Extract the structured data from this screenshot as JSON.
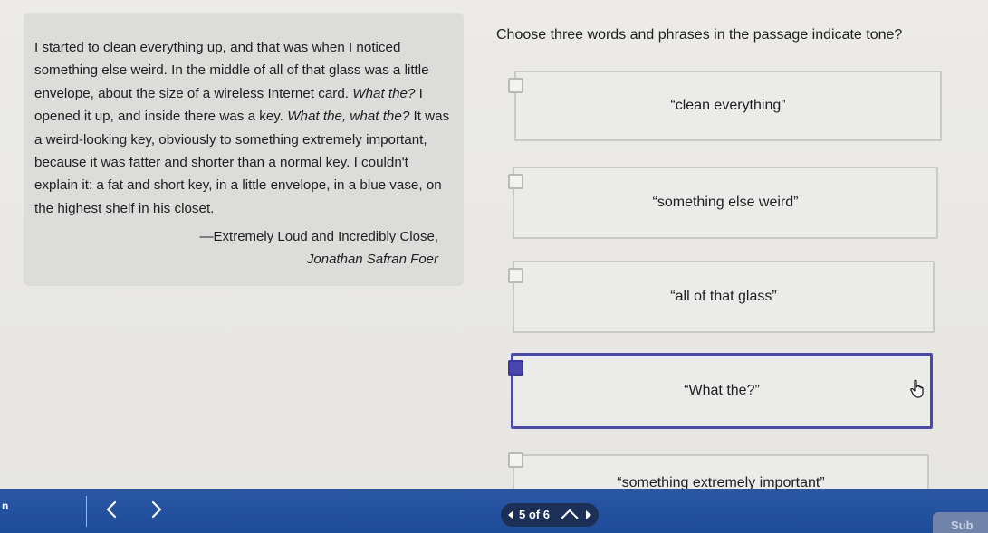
{
  "passage": {
    "segments": [
      {
        "text": "I started to clean everything up, and that was when I noticed something else weird. In the middle of all of that glass was a little envelope, about the size of a wireless Internet card. ",
        "italic": false
      },
      {
        "text": "What the?",
        "italic": true
      },
      {
        "text": " I opened it up, and inside there was a key. ",
        "italic": false
      },
      {
        "text": "What the, what the?",
        "italic": true
      },
      {
        "text": " It was a weird-looking key, obviously to something extremely important, because it was fatter and shorter than a normal key. I couldn't explain it: a fat and short key, in a little envelope, in a blue vase, on the highest shelf in his closet.",
        "italic": false
      }
    ],
    "source_title": "—Extremely Loud and Incredibly Close,",
    "author": "Jonathan Safran Foer"
  },
  "question": "Choose three words and phrases in the passage indicate tone?",
  "options": [
    {
      "label": "“clean everything”",
      "checked": false
    },
    {
      "label": "“something else weird”",
      "checked": false
    },
    {
      "label": "“all of that glass”",
      "checked": false
    },
    {
      "label": "“What the?”",
      "checked": true
    },
    {
      "label": "“something extremely important”",
      "checked": false
    }
  ],
  "icons": {
    "hover_cursor": "pointing-hand-icon",
    "prev": "chevron-left-icon",
    "next": "chevron-right-icon",
    "pager_prev": "triangle-left-icon",
    "pager_next": "triangle-right-icon",
    "pager_expand": "caret-up-icon"
  },
  "footer": {
    "left_stub": "n",
    "pager_text": "5 of 6",
    "submit_label": "Sub"
  },
  "colors": {
    "footer_bg": "#2453a0",
    "selected_border": "#4a4aa6",
    "checkbox_checked": "#4a46b0"
  }
}
